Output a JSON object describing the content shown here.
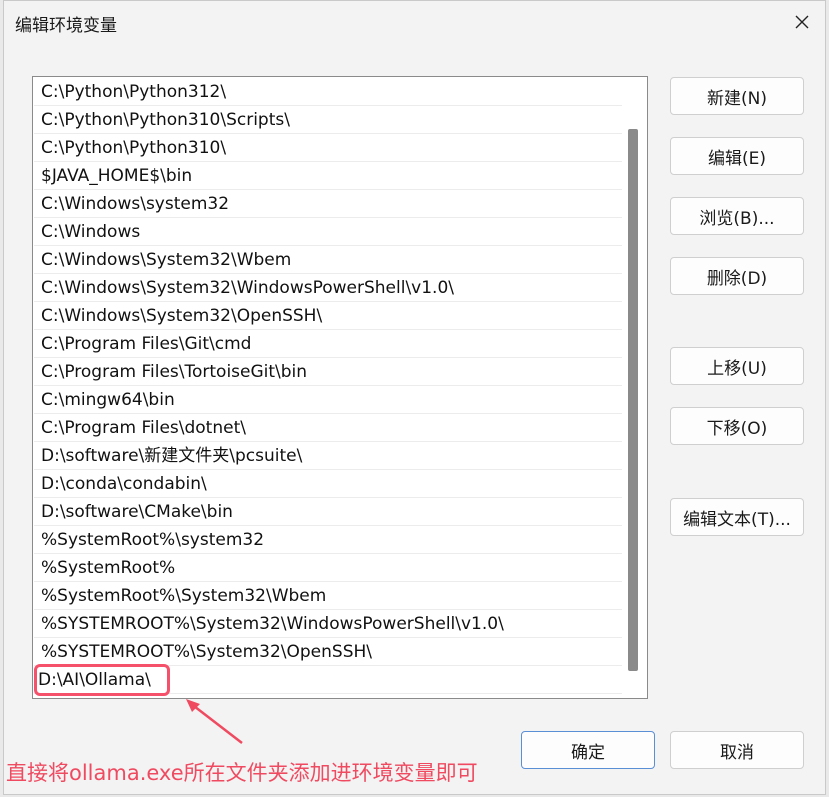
{
  "dialog": {
    "title": "编辑环境变量",
    "close_icon": "close-icon"
  },
  "path_list": {
    "items": [
      "C:\\Python\\Python312\\",
      "C:\\Python\\Python310\\Scripts\\",
      "C:\\Python\\Python310\\",
      "$JAVA_HOME$\\bin",
      "C:\\Windows\\system32",
      "C:\\Windows",
      "C:\\Windows\\System32\\Wbem",
      "C:\\Windows\\System32\\WindowsPowerShell\\v1.0\\",
      "C:\\Windows\\System32\\OpenSSH\\",
      "C:\\Program Files\\Git\\cmd",
      "C:\\Program Files\\TortoiseGit\\bin",
      "C:\\mingw64\\bin",
      "C:\\Program Files\\dotnet\\",
      "D:\\software\\新建文件夹\\pcsuite\\",
      "D:\\conda\\condabin\\",
      "D:\\software\\CMake\\bin",
      "%SystemRoot%\\system32",
      "%SystemRoot%",
      "%SystemRoot%\\System32\\Wbem",
      "%SYSTEMROOT%\\System32\\WindowsPowerShell\\v1.0\\",
      "%SYSTEMROOT%\\System32\\OpenSSH\\",
      "D:\\AI\\Ollama\\"
    ],
    "highlighted_index": 21
  },
  "buttons": {
    "new": "新建(N)",
    "edit": "编辑(E)",
    "browse": "浏览(B)...",
    "delete": "删除(D)",
    "move_up": "上移(U)",
    "move_down": "下移(O)",
    "edit_text": "编辑文本(T)...",
    "ok": "确定",
    "cancel": "取消"
  },
  "annotation": {
    "text": "直接将ollama.exe所在文件夹添加进环境变量即可",
    "color": "#ef4a60"
  },
  "colors": {
    "highlight": "#f5516b",
    "primary_border": "#5a8fd6"
  }
}
